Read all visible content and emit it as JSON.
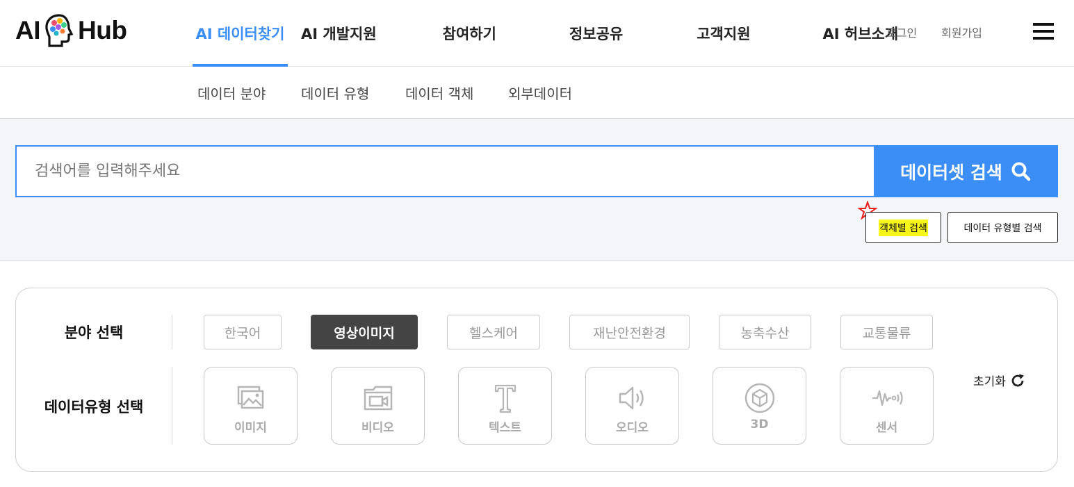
{
  "logo": {
    "left": "AI",
    "right": "Hub"
  },
  "gnb": [
    {
      "label": "AI 데이터찾기",
      "active": true
    },
    {
      "label": "AI 개발지원"
    },
    {
      "label": "참여하기"
    },
    {
      "label": "정보공유"
    },
    {
      "label": "고객지원"
    },
    {
      "label": "AI 허브소개"
    }
  ],
  "util": {
    "login": "로그인",
    "signup": "회원가입"
  },
  "subnav": [
    "데이터 분야",
    "데이터 유형",
    "데이터 객체",
    "외부데이터"
  ],
  "search": {
    "placeholder": "검색어를 입력해주세요",
    "button": "데이터셋 검색",
    "object_search": "객체별 검색",
    "type_search": "데이터 유형별 검색"
  },
  "filter": {
    "field_label": "분야 선택",
    "type_label": "데이터유형 선택",
    "fields": [
      "한국어",
      "영상이미지",
      "헬스케어",
      "재난안전환경",
      "농축수산",
      "교통물류"
    ],
    "selected_field": "영상이미지",
    "types": [
      {
        "label": "이미지",
        "icon": "image-icon"
      },
      {
        "label": "비디오",
        "icon": "video-icon"
      },
      {
        "label": "텍스트",
        "icon": "text-icon"
      },
      {
        "label": "오디오",
        "icon": "audio-icon"
      },
      {
        "label": "3D",
        "icon": "cube-3d-icon"
      },
      {
        "label": "센서",
        "icon": "sensor-icon"
      }
    ],
    "reset": "초기화"
  },
  "colors": {
    "accent": "#3b8ef6",
    "highlight": "#f6f61a",
    "selected": "#444444"
  }
}
